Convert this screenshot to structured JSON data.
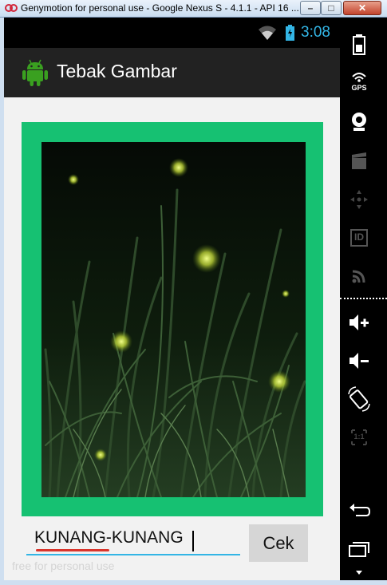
{
  "window": {
    "title": "Genymotion for personal use - Google Nexus S - 4.1.1 - API 16 ...",
    "minimize_label": "–",
    "maximize_label": "□",
    "close_label": "✕"
  },
  "statusbar": {
    "time": "3:08",
    "accent_color": "#33b5e5"
  },
  "actionbar": {
    "app_title": "Tebak Gambar",
    "icon": "android-robot-icon"
  },
  "main": {
    "image": "fireflies-in-grass-photo",
    "frame_color": "#16c172",
    "answer_value": "KUNANG-KUNANG",
    "check_label": "Cek",
    "watermark": "free for personal use"
  },
  "sidebar": {
    "items": [
      {
        "icon": "battery-icon"
      },
      {
        "icon": "gps-icon",
        "label": "GPS"
      },
      {
        "icon": "webcam-icon"
      },
      {
        "icon": "clapperboard-icon"
      },
      {
        "icon": "dpad-icon"
      },
      {
        "icon": "id-icon",
        "label": "ID"
      },
      {
        "icon": "cast-icon"
      },
      {
        "icon": "volume-up-icon"
      },
      {
        "icon": "volume-down-icon"
      },
      {
        "icon": "rotate-icon"
      },
      {
        "icon": "pixel-perfect-icon",
        "label": "1:1"
      },
      {
        "icon": "back-icon"
      },
      {
        "icon": "recent-apps-icon"
      }
    ]
  }
}
